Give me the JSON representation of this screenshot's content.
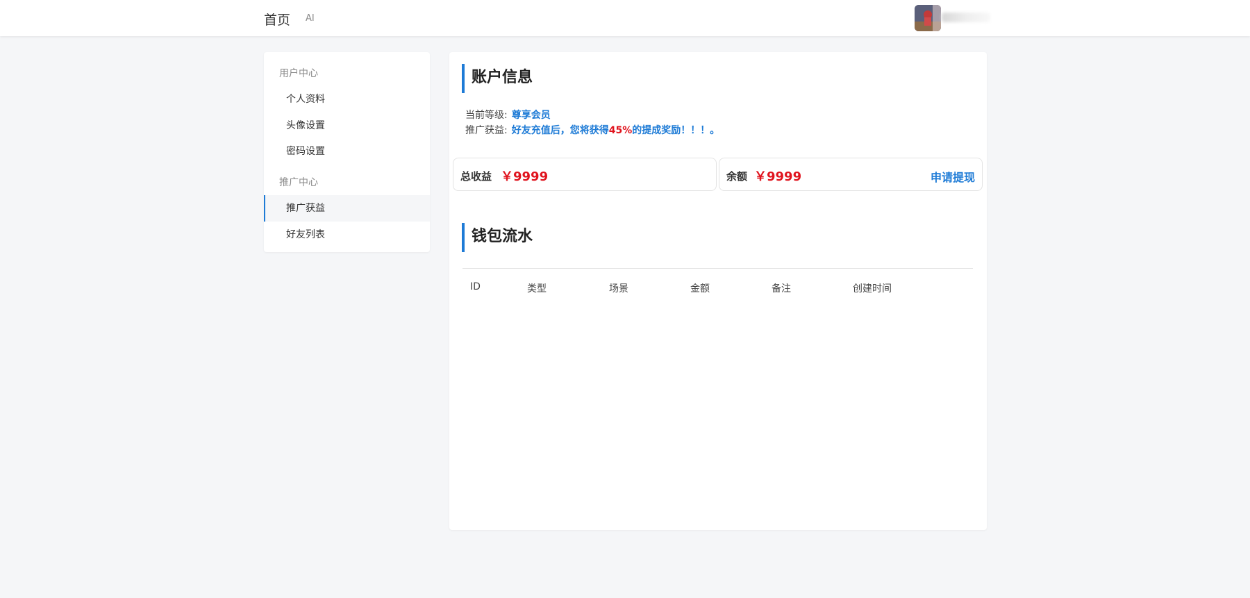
{
  "header": {
    "nav": {
      "home": "首页",
      "ai": "AI"
    }
  },
  "sidebar": {
    "groups": [
      {
        "title": "用户中心",
        "items": [
          "个人资料",
          "头像设置",
          "密码设置"
        ]
      },
      {
        "title": "推广中心",
        "items": [
          "推广获益",
          "好友列表"
        ]
      }
    ],
    "active_item": "推广获益"
  },
  "account": {
    "title": "账户信息",
    "level_label": "当前等级:",
    "level_value": "尊享会员",
    "promo_label": "推广获益:",
    "promo_pre": "好友充值后，您将获得",
    "promo_percent": "45%",
    "promo_post": "的提成奖励！！！。"
  },
  "stats": {
    "total_label": "总收益",
    "total_value": "￥9999",
    "balance_label": "余额",
    "balance_value": "￥9999",
    "withdraw_label": "申请提现"
  },
  "wallet": {
    "title": "钱包流水",
    "columns": [
      "ID",
      "类型",
      "场景",
      "金额",
      "备注",
      "创建时间"
    ]
  },
  "colors": {
    "accent": "#1e7bd6",
    "money": "#e0141e",
    "background": "#f5f6f8"
  }
}
